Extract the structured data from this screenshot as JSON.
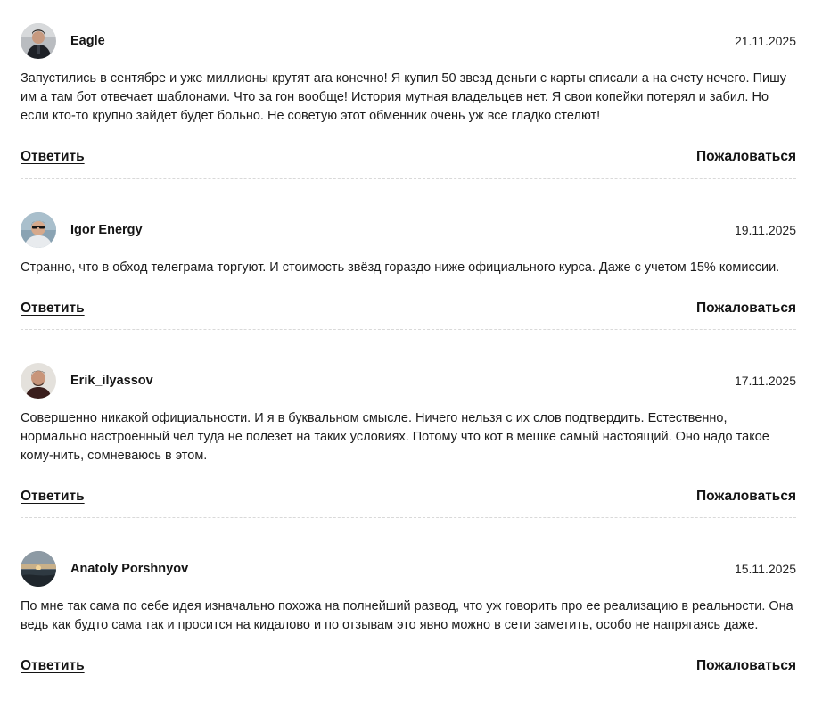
{
  "comments": [
    {
      "author": "Eagle",
      "date": "21.11.2025",
      "text": "Запустились в сентябре и уже миллионы крутят ага конечно! Я купил 50 звезд деньги с карты списали а на счету нечего. Пишу им а там бот отвечает шаблонами. Что за гон вообще! История мутная владельцев нет. Я свои копейки потерял и забил. Но если кто-то крупно зайдет будет больно. Не советую этот обменник очень уж все гладко стелют!",
      "reply_label": "Ответить",
      "report_label": "Пожаловаться",
      "avatar_icon": "avatar-photo-man-dark-jacket"
    },
    {
      "author": "Igor Energy",
      "date": "19.11.2025",
      "text": "Странно, что в обход телеграма торгуют. И стоимость звёзд гораздо ниже официального курса. Даже с учетом 15% комиссии.",
      "reply_label": "Ответить",
      "report_label": "Пожаловаться",
      "avatar_icon": "avatar-photo-man-sunglasses"
    },
    {
      "author": "Erik_ilyassov",
      "date": "17.11.2025",
      "text": "Совершенно никакой официальности. И я в буквальном смысле. Ничего нельзя с их слов подтвердить. Естественно, нормально настроенный чел туда не полезет на таких условиях. Потому что кот в мешке самый настоящий. Оно надо такое кому-нить, сомневаюсь в этом.",
      "reply_label": "Ответить",
      "report_label": "Пожаловаться",
      "avatar_icon": "avatar-photo-man-portrait"
    },
    {
      "author": "Anatoly Porshnyov",
      "date": "15.11.2025",
      "text": "По мне так сама по себе идея изначально похожа на полнейший развод, что уж говорить про ее реализацию в реальности. Она ведь как будто сама так и просится на кидалово и по отзывам это явно можно в сети заметить, особо не напрягаясь даже.",
      "reply_label": "Ответить",
      "report_label": "Пожаловаться",
      "avatar_icon": "avatar-photo-sunset-landscape"
    }
  ]
}
